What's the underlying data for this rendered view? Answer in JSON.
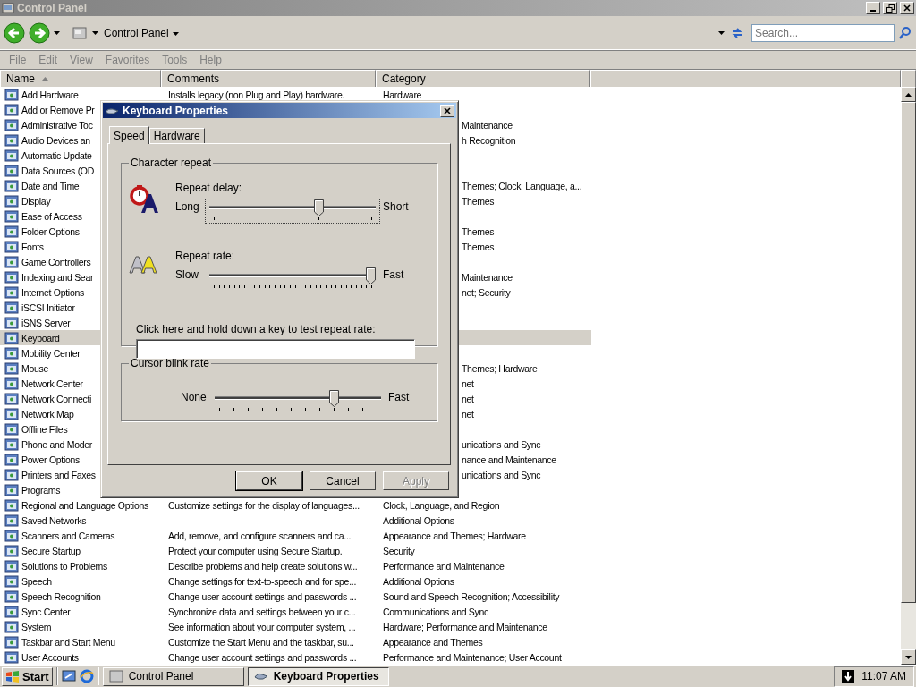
{
  "window": {
    "title": "Control Panel"
  },
  "toolbar": {
    "address": "Control Panel",
    "search_placeholder": "Search..."
  },
  "menu": [
    "File",
    "Edit",
    "View",
    "Favorites",
    "Tools",
    "Help"
  ],
  "list": {
    "columns": [
      {
        "label": "Name",
        "sorted": true
      },
      {
        "label": "Comments",
        "sorted": false
      },
      {
        "label": "Category",
        "sorted": false
      }
    ],
    "rows": [
      {
        "kind": "full",
        "name": "Add Hardware",
        "comment": "Installs legacy (non Plug and Play) hardware.",
        "category": "Hardware",
        "selected": false
      },
      {
        "kind": "covered",
        "name": "Add or Remove Pr",
        "selected": false
      },
      {
        "kind": "covered",
        "name": "Administrative Toc",
        "category": "Maintenance",
        "selected": false
      },
      {
        "kind": "covered",
        "name": "Audio Devices an",
        "category": "h Recognition",
        "selected": false
      },
      {
        "kind": "covered",
        "name": "Automatic Update",
        "selected": false
      },
      {
        "kind": "covered",
        "name": "Data Sources (OD",
        "selected": false
      },
      {
        "kind": "covered",
        "name": "Date and Time",
        "category": "Themes; Clock, Language, a...",
        "selected": false
      },
      {
        "kind": "covered",
        "name": "Display",
        "category": "Themes",
        "selected": false
      },
      {
        "kind": "covered",
        "name": "Ease of Access",
        "selected": false
      },
      {
        "kind": "covered",
        "name": "Folder Options",
        "category": "Themes",
        "selected": false
      },
      {
        "kind": "covered",
        "name": "Fonts",
        "category": "Themes",
        "selected": false
      },
      {
        "kind": "covered",
        "name": "Game Controllers",
        "selected": false
      },
      {
        "kind": "covered",
        "name": "Indexing and Sear",
        "category": "Maintenance",
        "selected": false
      },
      {
        "kind": "covered",
        "name": "Internet Options",
        "category": "net; Security",
        "selected": false
      },
      {
        "kind": "covered",
        "name": "iSCSI Initiator",
        "selected": false
      },
      {
        "kind": "covered",
        "name": "iSNS Server",
        "selected": false
      },
      {
        "kind": "covered",
        "name": "Keyboard",
        "selected": true
      },
      {
        "kind": "covered",
        "name": "Mobility Center",
        "selected": false
      },
      {
        "kind": "covered",
        "name": "Mouse",
        "category": "Themes; Hardware",
        "selected": false
      },
      {
        "kind": "covered",
        "name": "Network Center",
        "category": "net",
        "selected": false
      },
      {
        "kind": "covered",
        "name": "Network Connecti",
        "category": "net",
        "selected": false
      },
      {
        "kind": "covered",
        "name": "Network Map",
        "category": "net",
        "selected": false
      },
      {
        "kind": "covered",
        "name": "Offline Files",
        "selected": false
      },
      {
        "kind": "covered",
        "name": "Phone and Moder",
        "category": "unications and Sync",
        "selected": false
      },
      {
        "kind": "covered",
        "name": "Power Options",
        "category": "nance and Maintenance",
        "selected": false
      },
      {
        "kind": "covered",
        "name": "Printers and Faxes",
        "category": "unications and Sync",
        "selected": false
      },
      {
        "kind": "covered",
        "name": "Programs",
        "selected": false
      },
      {
        "kind": "full",
        "name": "Regional and Language Options",
        "comment": "Customize settings for the display of languages...",
        "category": "Clock, Language, and Region",
        "selected": false
      },
      {
        "kind": "full",
        "name": "Saved Networks",
        "category": "Additional Options",
        "selected": false
      },
      {
        "kind": "full",
        "name": "Scanners and Cameras",
        "comment": "Add, remove, and configure scanners and ca...",
        "category": "Appearance and Themes; Hardware",
        "selected": false
      },
      {
        "kind": "full",
        "name": "Secure Startup",
        "comment": "Protect your computer using Secure Startup.",
        "category": "Security",
        "selected": false
      },
      {
        "kind": "full",
        "name": "Solutions to Problems",
        "comment": "Describe problems and help create solutions w...",
        "category": "Performance and Maintenance",
        "selected": false
      },
      {
        "kind": "full",
        "name": "Speech",
        "comment": "Change settings for text-to-speech and for spe...",
        "category": "Additional Options",
        "selected": false
      },
      {
        "kind": "full",
        "name": "Speech Recognition",
        "comment": "Change user account settings and passwords ...",
        "category": "Sound and Speech Recognition; Accessibility",
        "selected": false
      },
      {
        "kind": "full",
        "name": "Sync Center",
        "comment": "Synchronize data and settings between your c...",
        "category": "Communications and Sync",
        "selected": false
      },
      {
        "kind": "full",
        "name": "System",
        "comment": "See information about your computer system, ...",
        "category": "Hardware; Performance and Maintenance",
        "selected": false
      },
      {
        "kind": "full",
        "name": "Taskbar and Start Menu",
        "comment": "Customize the Start Menu and the taskbar, su...",
        "category": "Appearance and Themes",
        "selected": false
      },
      {
        "kind": "full",
        "name": "User Accounts",
        "comment": "Change user account settings and passwords ...",
        "category": "Performance and Maintenance; User Account",
        "selected": false
      }
    ]
  },
  "dialog": {
    "title": "Keyboard Properties",
    "tabs": [
      {
        "label": "Speed",
        "selected": true
      },
      {
        "label": "Hardware",
        "selected": false
      }
    ],
    "character_repeat": {
      "title": "Character repeat",
      "sliders": [
        {
          "kind": "delay",
          "label": "Repeat delay:",
          "min_label": "Long",
          "max_label": "Short",
          "level": 0.667,
          "focused": true
        },
        {
          "kind": "rate",
          "label": "Repeat rate:",
          "min_label": "Slow",
          "max_label": "Fast",
          "level": 1.0,
          "focused": false
        }
      ],
      "test_label": "Click here and hold down a key to test repeat rate:"
    },
    "cursor_blink": {
      "title": "Cursor blink rate",
      "slider": {
        "kind": "blink",
        "min_label": "None",
        "max_label": "Fast",
        "level": 0.73,
        "focused": false
      }
    },
    "buttons": [
      {
        "label": "OK",
        "default": true,
        "disabled": false
      },
      {
        "label": "Cancel",
        "default": false,
        "disabled": false
      },
      {
        "label": "Apply",
        "default": false,
        "disabled": true
      }
    ]
  },
  "taskbar": {
    "start": "Start",
    "tasks": [
      {
        "label": "Control Panel",
        "selected": false
      },
      {
        "label": "Keyboard Properties",
        "selected": true
      }
    ],
    "clock": "11:07 AM"
  }
}
